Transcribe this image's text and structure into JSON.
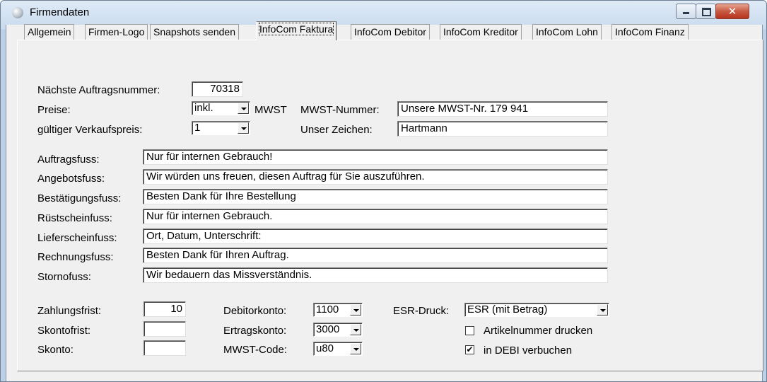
{
  "window": {
    "title": "Firmendaten"
  },
  "tabs": [
    "Allgemein",
    "Firmen-Logo",
    "Snapshots senden",
    "InfoCom Faktura",
    "InfoCom Debitor",
    "InfoCom Kreditor",
    "InfoCom Lohn",
    "InfoCom Finanz"
  ],
  "active_tab": "InfoCom Faktura",
  "header": {
    "next_order_label": "Nächste Auftragsnummer:",
    "next_order_value": "70318",
    "prices_label": "Preise:",
    "prices_value": "inkl.",
    "mwst_suffix": "MWST",
    "sale_price_label": "gültiger Verkaufspreis:",
    "sale_price_value": "1",
    "mwst_number_label": "MWST-Nummer:",
    "mwst_number_value": "Unsere MWST-Nr. 179 941",
    "our_sign_label": "Unser Zeichen:",
    "our_sign_value": "Hartmann"
  },
  "footers": [
    {
      "label": "Auftragsfuss:",
      "value": "Nur für internen Gebrauch!"
    },
    {
      "label": "Angebotsfuss:",
      "value": "Wir würden uns freuen, diesen Auftrag für Sie auszuführen."
    },
    {
      "label": "Bestätigungsfuss:",
      "value": "Besten Dank für Ihre Bestellung"
    },
    {
      "label": "Rüstscheinfuss:",
      "value": "Nur für internen Gebrauch."
    },
    {
      "label": "Lieferscheinfuss:",
      "value": "Ort, Datum, Unterschrift:"
    },
    {
      "label": "Rechnungsfuss:",
      "value": "Besten Dank für Ihren Auftrag."
    },
    {
      "label": "Stornofuss:",
      "value": "Wir bedauern das Missverständnis."
    }
  ],
  "payment": {
    "terms_label": "Zahlungsfrist:",
    "terms_value": "10",
    "discount_period_label": "Skontofrist:",
    "discount_period_value": "",
    "discount_label": "Skonto:",
    "discount_value": ""
  },
  "accounts": {
    "debitor_label": "Debitorkonto:",
    "debitor_value": "1100",
    "revenue_label": "Ertragskonto:",
    "revenue_value": "3000",
    "mwst_code_label": "MWST-Code:",
    "mwst_code_value": "u80"
  },
  "esr": {
    "label": "ESR-Druck:",
    "value": "ESR (mit Betrag)",
    "print_article_label": "Artikelnummer drucken",
    "print_article_checked": false,
    "debi_label": "in DEBI verbuchen",
    "debi_checked": true
  }
}
